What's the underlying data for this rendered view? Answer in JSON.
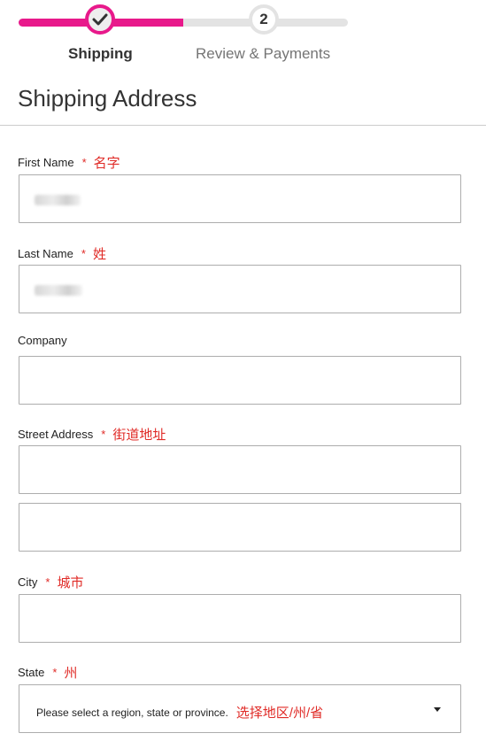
{
  "progress": {
    "steps": [
      {
        "label": "Shipping",
        "number": "",
        "state": "completed"
      },
      {
        "label": "Review & Payments",
        "number": "2",
        "state": "pending"
      }
    ],
    "fill_fraction": 0.5,
    "accent_color": "#e8198b"
  },
  "section": {
    "title": "Shipping Address"
  },
  "fields": {
    "first_name": {
      "label": "First Name",
      "required": "*",
      "hint": "名字"
    },
    "last_name": {
      "label": "Last Name",
      "required": "*",
      "hint": "姓"
    },
    "company": {
      "label": "Company"
    },
    "street": {
      "label": "Street Address",
      "required": "*",
      "hint": "街道地址"
    },
    "city": {
      "label": "City",
      "required": "*",
      "hint": "城市"
    },
    "state": {
      "label": "State",
      "required": "*",
      "hint": "州",
      "selected": "Please select a region, state or province.",
      "selected_hint": "选择地区/州/省"
    }
  }
}
